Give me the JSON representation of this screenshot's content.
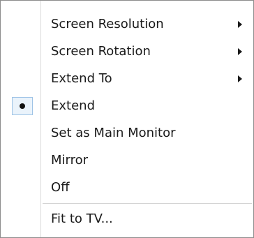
{
  "menu": {
    "items": [
      {
        "label": "Screen Resolution",
        "submenu": true
      },
      {
        "label": "Screen Rotation",
        "submenu": true
      },
      {
        "label": "Extend To",
        "submenu": true
      },
      {
        "label": "Extend",
        "selected": true
      },
      {
        "label": "Set as Main Monitor"
      },
      {
        "label": "Mirror"
      },
      {
        "label": "Off"
      },
      {
        "label": "Fit to TV..."
      }
    ],
    "icons": {
      "submenu": "chevron-right-icon",
      "selected": "radio-bullet-icon"
    },
    "colors": {
      "text": "#1a1a1a",
      "border": "#8c8c8c",
      "selection_highlight": "#eaf3fb",
      "selection_border": "#9ec3e6"
    }
  }
}
